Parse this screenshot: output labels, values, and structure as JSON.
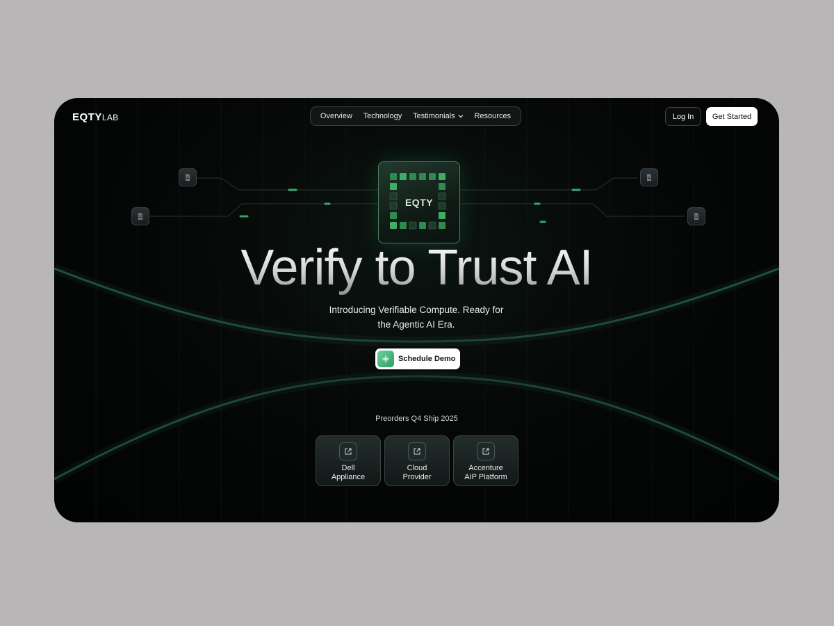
{
  "brand": {
    "logo_bold": "EQTY",
    "logo_light": "LAB"
  },
  "nav": {
    "items": [
      {
        "label": "Overview"
      },
      {
        "label": "Technology"
      },
      {
        "label": "Testimonials",
        "has_dropdown": true
      },
      {
        "label": "Resources"
      }
    ]
  },
  "header": {
    "login_label": "Log In",
    "get_started_label": "Get Started"
  },
  "chip": {
    "label": "EQTY",
    "icon": "processor-chip"
  },
  "hero": {
    "headline": "Verify to Trust AI",
    "subtitle_line1": "Introducing Verifiable Compute. Ready for",
    "subtitle_line2": "the Agentic AI Era.",
    "cta_label": "Schedule Demo",
    "cta_icon": "sparkle-icon"
  },
  "preorder": {
    "text": "Preorders Q4 Ship 2025",
    "partners": [
      {
        "line1": "Dell",
        "line2": "Appliance",
        "icon": "external-link-icon"
      },
      {
        "line1": "Cloud",
        "line2": "Provider",
        "icon": "external-link-icon"
      },
      {
        "line1": "Accenture",
        "line2": "AIP Platform",
        "icon": "external-link-icon"
      }
    ]
  },
  "colors": {
    "page_background": "#b8b6b7",
    "card_background": "#050807",
    "accent_green": "#3fbf78",
    "button_white": "#ffffff"
  }
}
